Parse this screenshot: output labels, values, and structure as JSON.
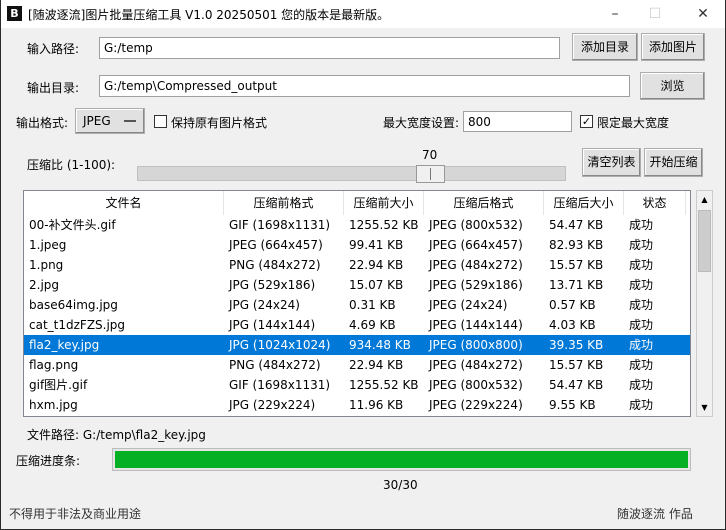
{
  "window": {
    "title": "[随波逐流]图片批量压缩工具 V1.0 20250501    您的版本是最新版。",
    "logo": "B",
    "minimize": "–",
    "maximize": "☐",
    "close": "✕"
  },
  "input": {
    "label": "输入路径:",
    "value": "G:/temp",
    "add_dir": "添加目录",
    "add_image": "添加图片"
  },
  "output": {
    "label": "输出目录:",
    "value": "G:/temp\\Compressed_output",
    "browse": "浏览"
  },
  "format": {
    "label": "输出格式:",
    "selected": "JPEG",
    "keep_label": "保持原有图片格式",
    "keep_checked": false,
    "max_width_label": "最大宽度设置:",
    "max_width": "800",
    "limit_label": "限定最大宽度",
    "limit_checked": true
  },
  "compression": {
    "label": "压缩比 (1-100):",
    "value": "70",
    "min": 1,
    "max": 100,
    "clear": "清空列表",
    "start": "开始压缩"
  },
  "table": {
    "columns": [
      "文件名",
      "压缩前格式",
      "压缩前大小",
      "压缩后格式",
      "压缩后大小",
      "状态"
    ],
    "rows": [
      [
        "00-补文件头.gif",
        "GIF (1698x1131)",
        "1255.52 KB",
        "JPEG (800x532)",
        "54.47 KB",
        "成功"
      ],
      [
        "1.jpeg",
        "JPEG (664x457)",
        "99.41 KB",
        "JPEG (664x457)",
        "82.93 KB",
        "成功"
      ],
      [
        "1.png",
        "PNG (484x272)",
        "22.94 KB",
        "JPEG (484x272)",
        "15.57 KB",
        "成功"
      ],
      [
        "2.jpg",
        "JPG (529x186)",
        "15.07 KB",
        "JPEG (529x186)",
        "13.71 KB",
        "成功"
      ],
      [
        "base64img.jpg",
        "JPG (24x24)",
        "0.31 KB",
        "JPEG (24x24)",
        "0.57 KB",
        "成功"
      ],
      [
        "cat_t1dzFZS.jpg",
        "JPG (144x144)",
        "4.69 KB",
        "JPEG (144x144)",
        "4.03 KB",
        "成功"
      ],
      [
        "fla2_key.jpg",
        "JPG (1024x1024)",
        "934.48 KB",
        "JPEG (800x800)",
        "39.35 KB",
        "成功"
      ],
      [
        "flag.png",
        "PNG (484x272)",
        "22.94 KB",
        "JPEG (484x272)",
        "15.57 KB",
        "成功"
      ],
      [
        "gif图片.gif",
        "GIF (1698x1131)",
        "1255.52 KB",
        "JPEG (800x532)",
        "54.47 KB",
        "成功"
      ],
      [
        "hxm.jpg",
        "JPG (229x224)",
        "11.96 KB",
        "JPEG (229x224)",
        "9.55 KB",
        "成功"
      ]
    ],
    "selected_index": 6
  },
  "filepath": "文件路径: G:/temp\\fla2_key.jpg",
  "progress": {
    "label": "压缩进度条:",
    "percent": 100,
    "text": "30/30",
    "color": "#06b025"
  },
  "footer": {
    "left": "不得用于非法及商业用途",
    "right": "随波逐流 作品"
  }
}
